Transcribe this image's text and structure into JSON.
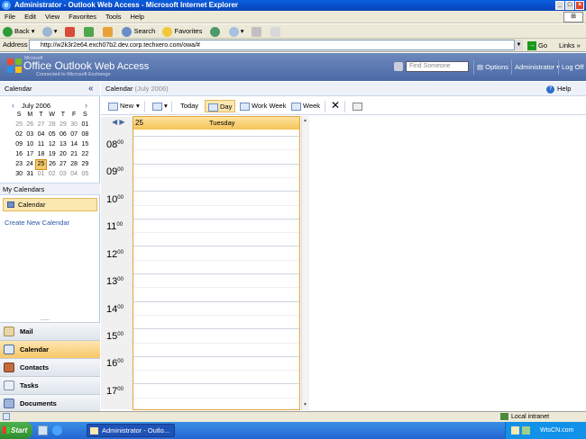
{
  "window": {
    "title": "Administrator - Outlook Web Access - Microsoft Internet Explorer"
  },
  "menu": [
    "File",
    "Edit",
    "View",
    "Favorites",
    "Tools",
    "Help"
  ],
  "toolbar": {
    "back": "Back",
    "search": "Search",
    "favorites": "Favorites"
  },
  "address": {
    "label": "Address",
    "url": "http://w2k3r2e64.exch07b2.dev.corp.techxero.com/owa/#",
    "go": "Go",
    "links": "Links"
  },
  "owa": {
    "ms": "Microsoft",
    "title_a": "Office Outlook",
    "title_b": " Web Access",
    "subtitle": "Connected to Microsoft Exchange",
    "find_placeholder": "Find Someone",
    "options": "Options",
    "user": "Administrator",
    "logoff": "Log Off"
  },
  "left": {
    "header": "Calendar",
    "month": "July 2006",
    "weekdays": [
      "S",
      "M",
      "T",
      "W",
      "T",
      "F",
      "S"
    ],
    "weeks": [
      [
        "25",
        "26",
        "27",
        "28",
        "29",
        "30",
        "01"
      ],
      [
        "02",
        "03",
        "04",
        "05",
        "06",
        "07",
        "08"
      ],
      [
        "09",
        "10",
        "11",
        "12",
        "13",
        "14",
        "15"
      ],
      [
        "16",
        "17",
        "18",
        "19",
        "20",
        "21",
        "22"
      ],
      [
        "23",
        "24",
        "25",
        "26",
        "27",
        "28",
        "29"
      ],
      [
        "30",
        "31",
        "01",
        "02",
        "03",
        "04",
        "05"
      ]
    ],
    "my_calendars": "My Calendars",
    "calendar_item": "Calendar",
    "create_new": "Create New Calendar",
    "splitter": "......",
    "nav": [
      "Mail",
      "Calendar",
      "Contacts",
      "Tasks",
      "Documents"
    ]
  },
  "right": {
    "header_label": "Calendar",
    "header_date": "(July 2006)",
    "help": "Help",
    "tools": {
      "new": "New",
      "today": "Today",
      "day": "Day",
      "work_week": "Work Week",
      "week": "Week"
    },
    "day_number": "25",
    "day_name": "Tuesday",
    "hours": [
      "08",
      "09",
      "10",
      "11",
      "12",
      "13",
      "14",
      "15",
      "16",
      "17"
    ],
    "minutes": "00"
  },
  "status": {
    "zone": "Local intranet"
  },
  "taskbar": {
    "start": "Start",
    "task": "Administrator - Outlo...",
    "watermark": "WtsCN.com"
  }
}
